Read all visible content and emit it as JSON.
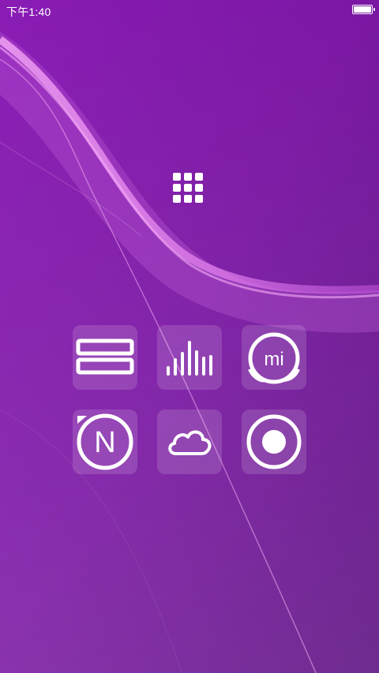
{
  "status_bar": {
    "time": "下午1:40",
    "battery_icon": "battery-icon"
  },
  "app_drawer": {
    "icon": "app-drawer-grid-icon"
  },
  "tiles": [
    {
      "icon": "list-lines-icon"
    },
    {
      "icon": "equalizer-icon"
    },
    {
      "icon": "mi-chat-icon",
      "label": "mi"
    },
    {
      "icon": "n-circle-icon",
      "label": "N"
    },
    {
      "icon": "cloud-icon"
    },
    {
      "icon": "record-circle-icon"
    }
  ],
  "colors": {
    "wallpaper_primary": "#7a17a3",
    "wallpaper_dark": "#5b0f80",
    "accent_wave": "#f08bf2",
    "tile_background": "rgba(255,255,255,0.14)",
    "icon_color": "#ffffff"
  }
}
